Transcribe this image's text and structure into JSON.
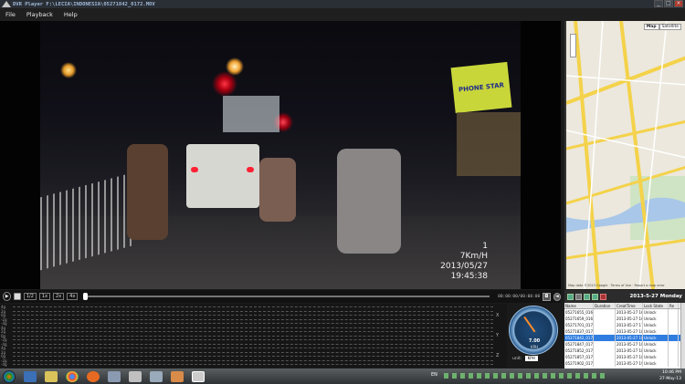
{
  "window": {
    "title": "DVR Player  F:\\LECIA\\INDONESIA\\05271842_0172.MOV"
  },
  "menu": {
    "file": "File",
    "playback": "Playback",
    "help": "Help"
  },
  "video": {
    "osd_line1": "1",
    "osd_speed": "7Km/H",
    "osd_date": "2013/05/27",
    "osd_time": "19:45:38",
    "shop_sign": "PHONE STAR"
  },
  "controls": {
    "speeds": [
      "1/2",
      "1x",
      "2x",
      "4x"
    ],
    "timecode": "00:00:00/00:00:00",
    "progress": 0.0
  },
  "graphs": {
    "y_labels": [
      "4g",
      "2g",
      "0g",
      "-2g",
      "-4g",
      "4g",
      "2g",
      "0g",
      "-2g",
      "-4g",
      "4g",
      "2g",
      "0g",
      "-2g",
      "-4g"
    ],
    "axis_tags": [
      "X",
      "Y",
      "Z"
    ]
  },
  "gauge": {
    "value": "7.00",
    "unit": "KPH",
    "unit_label": "unit:",
    "unit_select": "KPH"
  },
  "map": {
    "tab_map": "Map",
    "tab_satellite": "Satellite",
    "credit": "Map data ©2013 Google · Terms of Use · Report a map error"
  },
  "file_panel": {
    "date": "2013-5-27 Monday",
    "headers": [
      "Name",
      "Duration",
      "CreatTime",
      "Lock State",
      "Re"
    ],
    "rows": [
      [
        "05271655_0168",
        "",
        "2013-05-27 16:55:00",
        "Unlock",
        ""
      ],
      [
        "05271659_0169",
        "",
        "2013-05-27 16:59:00",
        "Unlock",
        ""
      ],
      [
        "05271701_0170",
        "",
        "2013-05-27 17:01:00",
        "Unlock",
        ""
      ],
      [
        "05271837_0171",
        "",
        "2013-05-27 18:37:00",
        "Unlock",
        ""
      ],
      [
        "05271842_0172",
        "",
        "2013-05-27 18:42:00",
        "Unlock",
        ""
      ],
      [
        "05271847_0173",
        "",
        "2013-05-27 18:47:00",
        "Unlock",
        ""
      ],
      [
        "05271852_0174",
        "",
        "2013-05-27 18:52:00",
        "Unlock",
        ""
      ],
      [
        "05271857_0175",
        "",
        "2013-05-27 18:57:00",
        "Unlock",
        ""
      ],
      [
        "05271902_0176",
        "",
        "2013-05-27 19:02:00",
        "Unlock",
        ""
      ]
    ],
    "selected_index": 4
  },
  "taskbar": {
    "lang": "EN",
    "time": "10:46 PM",
    "date": "27-May-13"
  },
  "colors": {
    "accent": "#2f7de0",
    "background": "#1b1b1b",
    "needle": "#ff8c2a"
  }
}
